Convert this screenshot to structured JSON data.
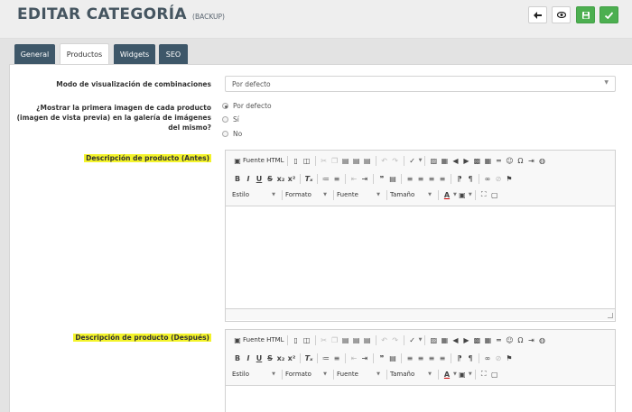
{
  "header": {
    "title": "EDITAR CATEGORÍA",
    "subtitle": "(BACKUP)",
    "buttons": [
      {
        "name": "back",
        "icon": "arrow-left-icon"
      },
      {
        "name": "preview",
        "icon": "eye-icon"
      },
      {
        "name": "save",
        "icon": "floppy-icon",
        "color": "#4caf50"
      },
      {
        "name": "save-close",
        "icon": "check-icon",
        "color": "#4caf50"
      }
    ]
  },
  "tabs": [
    {
      "label": "General",
      "active": false
    },
    {
      "label": "Productos",
      "active": true
    },
    {
      "label": "Widgets",
      "active": false
    },
    {
      "label": "SEO",
      "active": false
    }
  ],
  "form": {
    "display_mode": {
      "label": "Modo de visualización de combinaciones",
      "value": "Por defecto"
    },
    "first_image": {
      "label_lines": [
        "¿Mostrar la primera imagen de cada producto",
        "(imagen de vista previa) en la galería de imágenes",
        "del mismo?"
      ],
      "options": [
        {
          "label": "Por defecto",
          "checked": true
        },
        {
          "label": "Sí",
          "checked": false
        },
        {
          "label": "No",
          "checked": false
        }
      ]
    },
    "desc_before_label": "Descripción de producto (Antes)",
    "desc_after_label": "Descripción de producto (Después)"
  },
  "editor_toolbar": {
    "source_label": "Fuente HTML",
    "combos": [
      "Estilo",
      "Formato",
      "Fuente",
      "Tamaño"
    ]
  },
  "colors": {
    "tab_dark": "#3e5769",
    "highlight": "#f3f32a",
    "green": "#4caf50"
  }
}
